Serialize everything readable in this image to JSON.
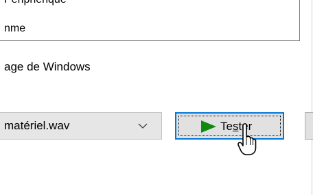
{
  "events_list": {
    "clipped_item": "Périphérique",
    "current_item": "nme"
  },
  "scheme_label": "age de Windows",
  "sound_select": {
    "selected_value": "matériel.wav",
    "chevron_icon": "chevron-down-icon"
  },
  "test_button": {
    "label_before": "Te",
    "mnemonic": "s",
    "label_after": "ter",
    "icon": "play-icon",
    "icon_color": "#0f8a0f",
    "focus_color": "#0078d7"
  },
  "cursor": {
    "icon": "hand-pointer-icon"
  }
}
